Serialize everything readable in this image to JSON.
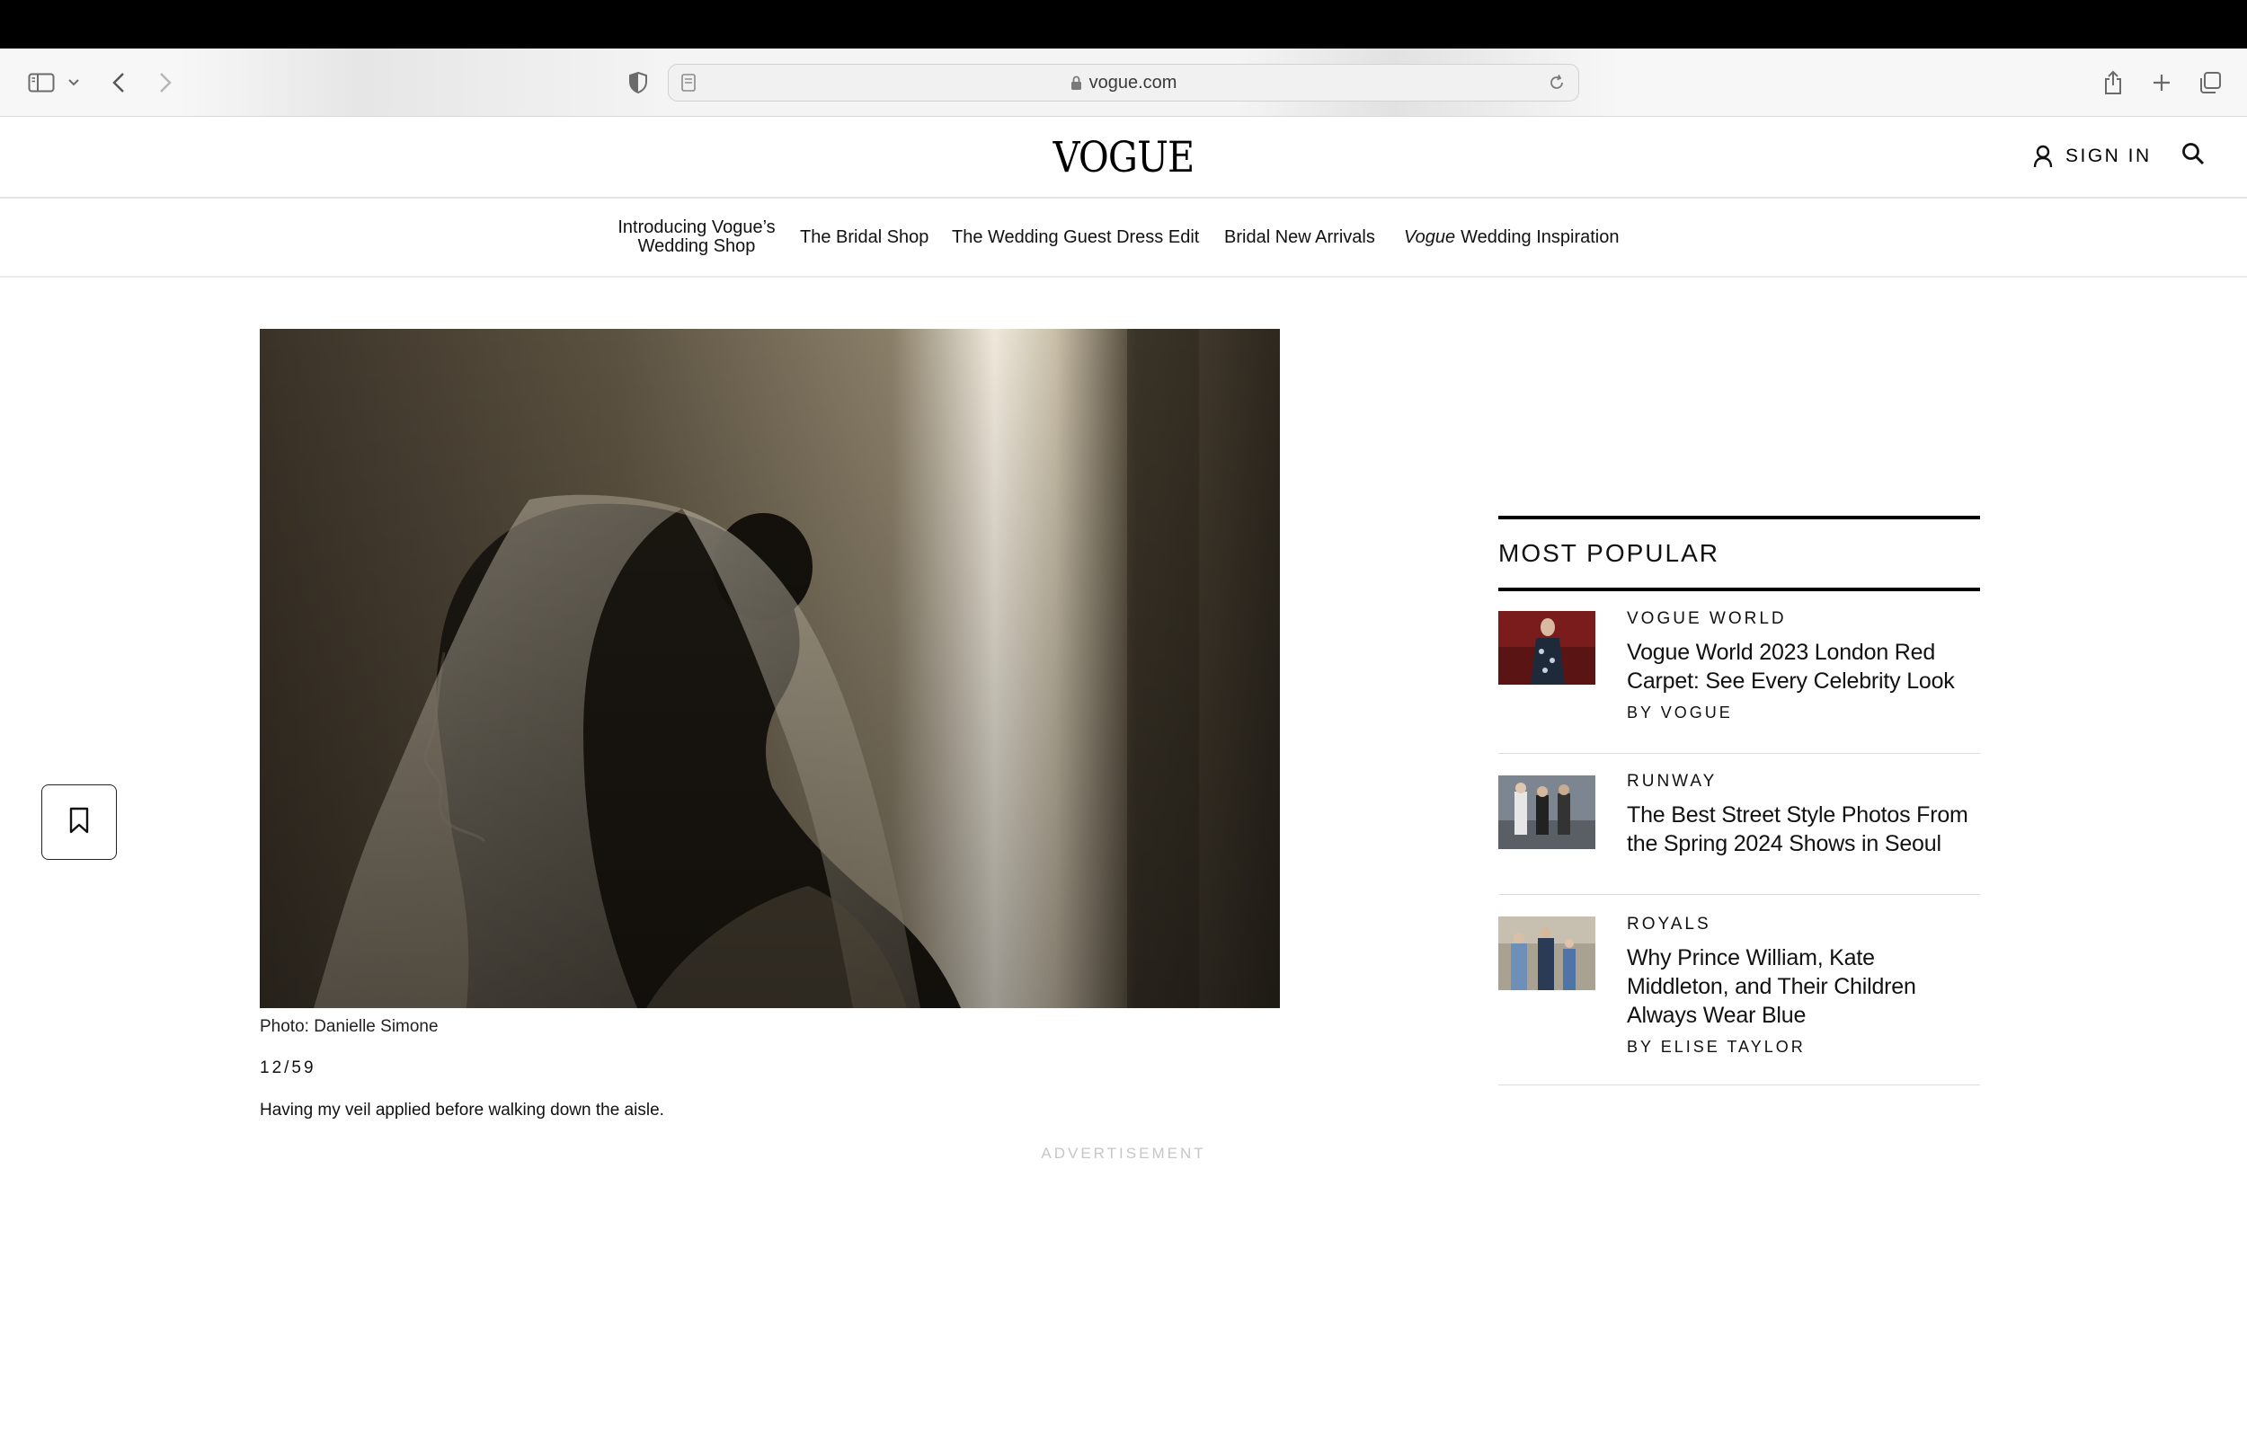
{
  "browser": {
    "url": "vogue.com"
  },
  "site": {
    "logo": "VOGUE",
    "sign_in": "SIGN IN"
  },
  "subnav": [
    {
      "line1": "Introducing Vogue’s",
      "line2": "Wedding Shop"
    },
    {
      "label": "The Bridal Shop"
    },
    {
      "label": "The Wedding Guest Dress Edit"
    },
    {
      "label": "Bridal New Arrivals"
    },
    {
      "italic": "Vogue",
      "label": "Wedding Inspiration"
    }
  ],
  "slide": {
    "credit": "Photo: Danielle Simone",
    "counter": "12/59",
    "caption": "Having my veil applied before walking down the aisle.",
    "advertisement": "ADVERTISEMENT"
  },
  "most_popular": {
    "title": "MOST POPULAR",
    "items": [
      {
        "category": "VOGUE WORLD",
        "headline": "Vogue World 2023 London Red Carpet: See Every Celebrity Look",
        "byline": "BY VOGUE"
      },
      {
        "category": "RUNWAY",
        "headline": "The Best Street Style Photos From the Spring 2024 Shows in Seoul",
        "byline": ""
      },
      {
        "category": "ROYALS",
        "headline": "Why Prince William, Kate Middleton, and Their Children Always Wear Blue",
        "byline": "BY ELISE TAYLOR"
      }
    ]
  },
  "icons": [
    "sidebar-icon",
    "chevron-down-icon",
    "back-icon",
    "forward-icon",
    "shield-icon",
    "page-icon",
    "lock-icon",
    "reload-icon",
    "share-icon",
    "new-tab-icon",
    "tabs-icon",
    "user-icon",
    "search-icon",
    "bookmark-icon"
  ]
}
